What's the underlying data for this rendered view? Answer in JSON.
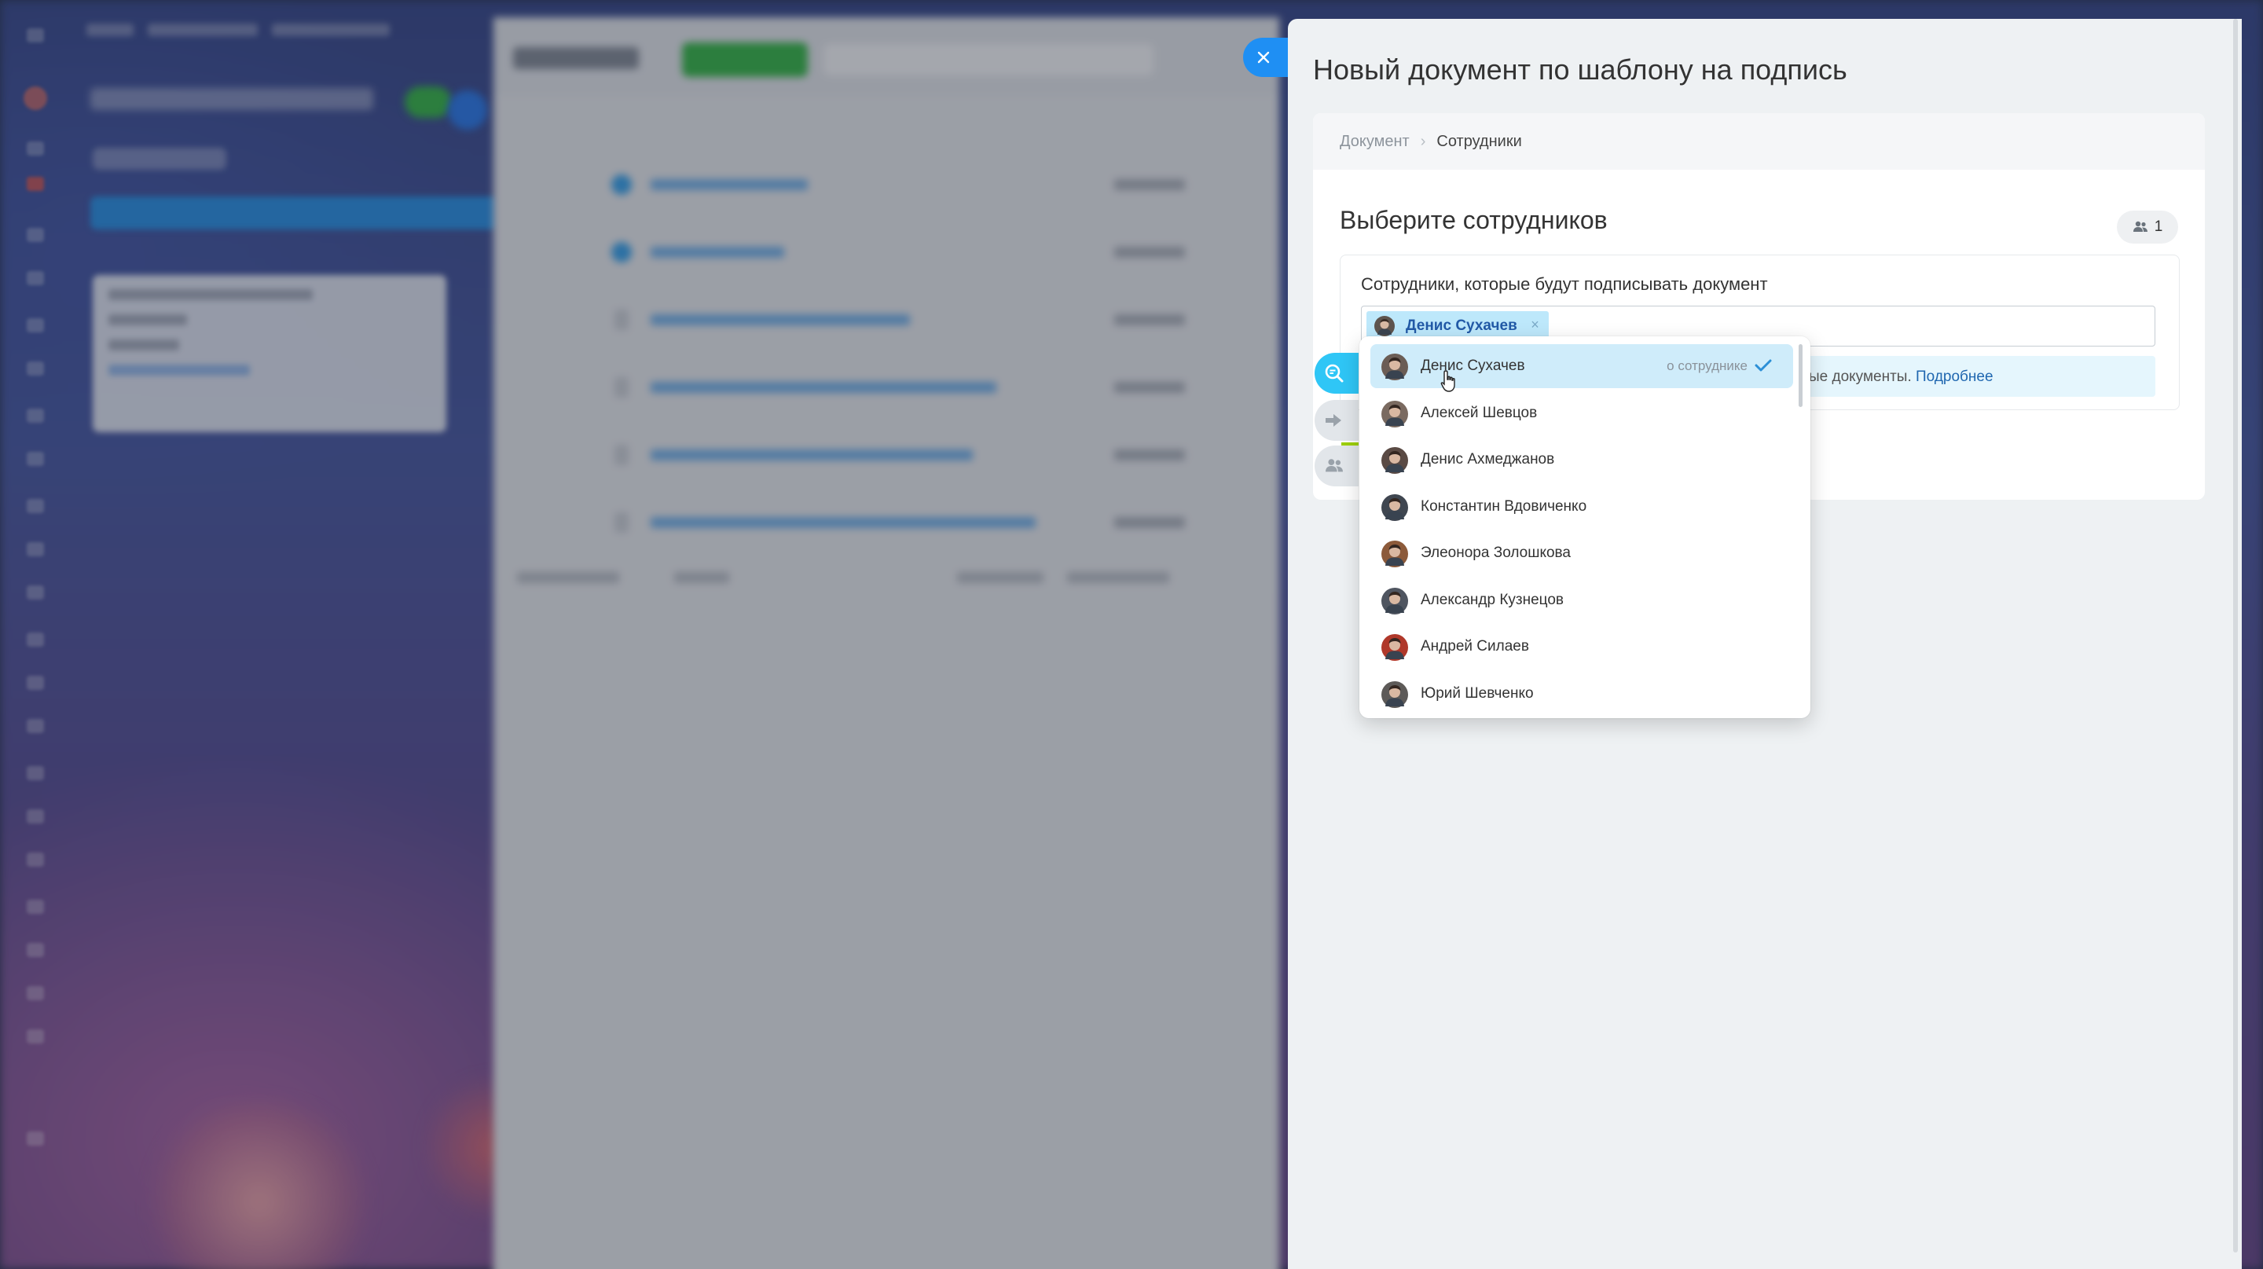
{
  "panel": {
    "title": "Новый документ по шаблону на подпись",
    "breadcrumbs": [
      "Документ",
      "Сотрудники"
    ],
    "section_title": "Выберите сотрудников",
    "counter": "1",
    "field_label": "Сотрудники, которые будут подписывать документ",
    "selected_tag": "Денис Сухачев",
    "info_text": "ые документы.",
    "info_link": "Подробнее"
  },
  "dropdown": {
    "about_label": "о сотруднике",
    "items": [
      {
        "name": "Денис Сухачев",
        "selected": true,
        "color": "#6b5d55"
      },
      {
        "name": "Алексей Шевцов",
        "selected": false,
        "color": "#7a6a60"
      },
      {
        "name": "Денис Ахмеджанов",
        "selected": false,
        "color": "#5a4a44"
      },
      {
        "name": "Константин Вдовиченко",
        "selected": false,
        "color": "#3f4650"
      },
      {
        "name": "Элеонора Золошкова",
        "selected": false,
        "color": "#8c5a3a"
      },
      {
        "name": "Александр Кузнецов",
        "selected": false,
        "color": "#4f5560"
      },
      {
        "name": "Андрей Силаев",
        "selected": false,
        "color": "#b0382a"
      },
      {
        "name": "Юрий Шевченко",
        "selected": false,
        "color": "#5d5a58"
      }
    ]
  },
  "colors": {
    "accent": "#2fc6f6",
    "close_button": "#1f8ff3",
    "tag_bg": "#bde8fb",
    "tag_text": "#225aa7",
    "selected_row": "#cfecfa",
    "progress": "#9dcf00"
  },
  "icons": {
    "close": "close-icon",
    "counter": "users-icon",
    "step1": "search-doc-icon",
    "step2": "arrow-right-icon",
    "step3": "users-icon",
    "check": "check-icon"
  }
}
